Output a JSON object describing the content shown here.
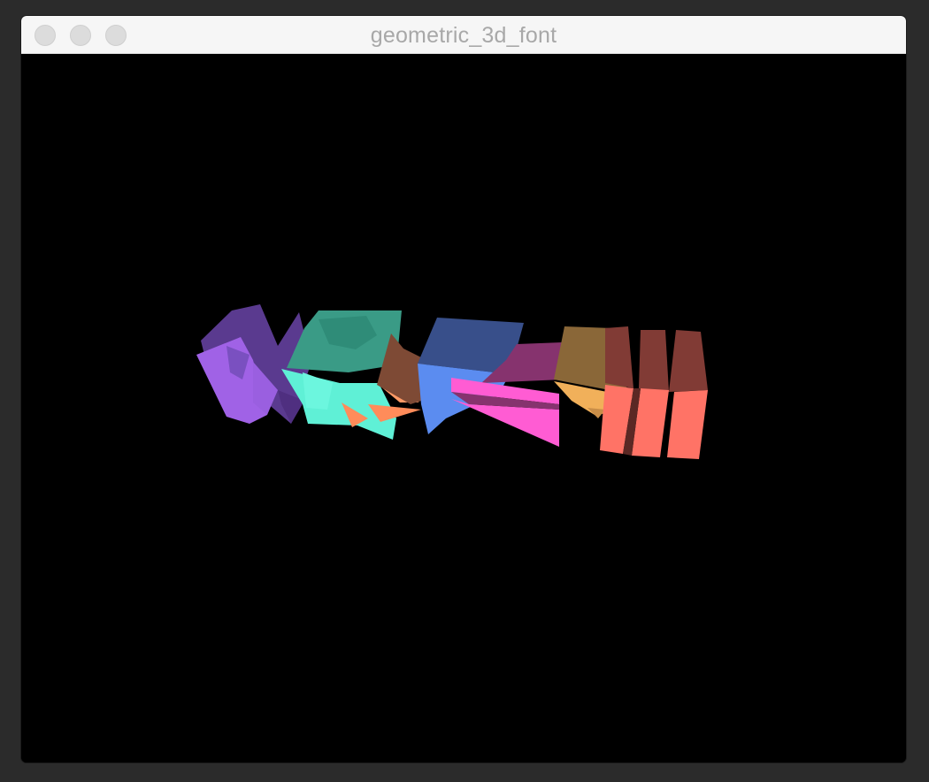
{
  "window": {
    "title": "geometric_3d_font",
    "background": "#000000"
  },
  "scene": {
    "description_colors": {
      "purple": "#a062e6",
      "purple_dark": "#5a3a8f",
      "teal": "#5ff0d6",
      "teal_dark": "#3a9b86",
      "brown": "#7e4a35",
      "orange": "#ff8c5a",
      "blue": "#5b8cf0",
      "blue_dark": "#384f8a",
      "pink": "#ff5cd3",
      "magenta_dark": "#86336e",
      "tan": "#f1b05a",
      "tan_dark": "#8a6738",
      "salmon": "#ff7366",
      "salmon_dark": "#813b35"
    }
  }
}
